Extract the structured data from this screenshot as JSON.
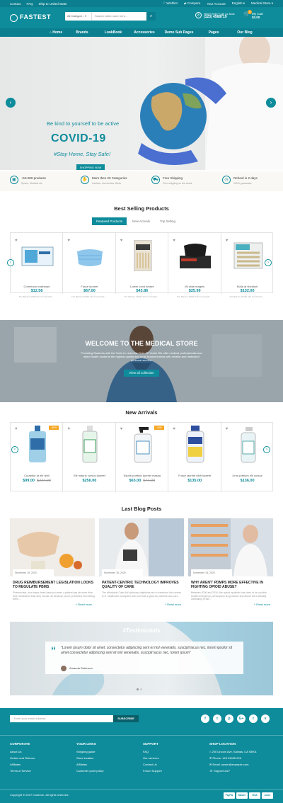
{
  "topbar": {
    "left": [
      "Contact",
      "FAQ",
      "Ship to United State"
    ],
    "right": [
      "♡ Wishlist",
      "⇄ Compare",
      "Your Account",
      "English ▾",
      "Medical Store ▾"
    ]
  },
  "header": {
    "logo": "FASTEST",
    "search_category": "All Categori... ▾",
    "search_placeholder": "Search entire store here...",
    "help_label": "Need Help? Call us Now",
    "help_phone": "(123) 4568719",
    "cart_label": "My Cart",
    "cart_total": "$0.00",
    "cart_count": "0"
  },
  "nav": [
    "Home",
    "Brands",
    "LookBook",
    "Accessories",
    "Demo Sub Pages",
    "Pages",
    "Our Blog"
  ],
  "hero": {
    "line1": "Be kind to yourself to be active",
    "line2": "COVID-19",
    "line3": "#Stay Home, Stay Safe!",
    "button": "SHOPPING NOW"
  },
  "features": [
    {
      "title": "+15.000 products",
      "sub": "Sports, Medical etc",
      "icon": "box-icon"
    },
    {
      "title": "More then 20 Categories",
      "sub": "Fashion, electronics, Book",
      "icon": "thumb-icon"
    },
    {
      "title": "Free Shipping",
      "sub": "Free shipping on the world.",
      "icon": "truck-icon"
    },
    {
      "title": "Refund in 2 days",
      "sub": "100% guarantee",
      "icon": "clock-icon"
    }
  ],
  "best_selling": {
    "title": "Best Selling Products",
    "tabs": [
      "Featured Products",
      "New Arrivals",
      "Top Selling"
    ],
    "products": [
      {
        "name": "Commodo malesuae",
        "price": "$12.56",
        "desc": "The Balnius 30290-110 Comfortabl..."
      },
      {
        "name": "Fusce laoreet",
        "price": "$67.00",
        "desc": "The Balnius 30290-110 Comfortabl..."
      },
      {
        "name": "Lorem cond amare",
        "price": "$43.86",
        "desc": "The Balnius 30290-110 Comfortabl..."
      },
      {
        "name": "Mi vitae magnis",
        "price": "$25.99",
        "desc": "The Balnius 30290-110 Comfortabl..."
      },
      {
        "name": "Nulla at tincidunt",
        "price": "$132.00",
        "desc": "The Balnius 30290-110 Comfortabl..."
      }
    ]
  },
  "banner": {
    "title": "WELCOME TO THE MEDICAL STORE",
    "desc": "Providing Students with the Tools to Learn for Over 20 Years! We offer medical professionals and allied health students the highest quality and most trusted brands with reliable and dedicated personal service.",
    "button": "View all collection"
  },
  "new_arrivals": {
    "title": "New Arrivals",
    "products": [
      {
        "name": "Curabitur at elit nibh",
        "price": "$99.00",
        "old": "$234.00",
        "sale": "-50%"
      },
      {
        "name": "Elit mauris cursus laoreet",
        "price": "$256.00",
        "old": "",
        "sale": ""
      },
      {
        "name": "Espire porttitor laoreet massa",
        "price": "$65.00",
        "old": "$77.00",
        "sale": "-15%"
      },
      {
        "name": "Fusce laoreet nibh laoreet",
        "price": "$135.00",
        "old": "",
        "sale": ""
      },
      {
        "name": "Urna pretium elit cursus",
        "price": "$136.00",
        "old": "",
        "sale": ""
      }
    ]
  },
  "blog": {
    "title": "Last Blog Posts",
    "posts": [
      {
        "date": "November 15, 2020",
        "title": "DRUG REIMBURSEMENT LEGISLATION LOOKS TO REGULATE PBMS",
        "excerpt": "Pharmacists, how many times have you seen a patient pay far more than their medication than they should, all because you're prohibited from telling them...",
        "more": "+ Read more"
      },
      {
        "date": "November 15, 2020",
        "title": "PATIENT-CENTRIC TECHNOLOGY IMPROVES QUALITY OF CARE",
        "excerpt": "The affordable Care Act's primary objectives are to transform the current U.S. healthcare ecosystem into one that is good for patients who can...",
        "more": "+ Read more"
      },
      {
        "date": "November 15, 2020",
        "title": "WHY AREN'T PDMPS MORE EFFECTIVE IN FIGHTING OPIOID ABUSE?",
        "excerpt": "Between 2000 and 2016, the opioid epidemic has risen to be a public health emergency, prescription drug misuse and abuse were steadily increasing in the...",
        "more": "+ Read more"
      }
    ]
  },
  "testimonials": {
    "title": "#Testimonials",
    "quote": "\"Lorem ipsum dolor sit amet, consectetur adipiscing sent et nisl venenatis, suscipit lacus nec, lorem ipsolor sit amet consectetur adipiscing sent et nisl venenatis, suscipit lacus nec, lorem ipsum\"",
    "author": "Amanda Robinson"
  },
  "footer": {
    "newsletter_placeholder": "Enter your email address",
    "subscribe": "SUBSCRIBE",
    "social": [
      "f",
      "t",
      "p",
      "G+",
      "t",
      "v"
    ],
    "cols": [
      {
        "title": "CORPORATE",
        "links": [
          "About Us",
          "Orders and Returns",
          "Affiliates",
          "Terms of Service"
        ]
      },
      {
        "title": "YOUR LINKS",
        "links": [
          "Shipping guide",
          "Store location",
          "Affiliates",
          "Customer point policy"
        ]
      },
      {
        "title": "SUPPORT",
        "links": [
          "FAQ",
          "Our services",
          "Contact Us",
          "Forum Support"
        ]
      },
      {
        "title": "SHOP LOCATION",
        "links": [
          "⌂ 200 Lincoln Ave, Salinas, CA 93901",
          "✆ Phone: 123 33425 225",
          "✉ Email: owner@example.com",
          "☏ Support 24/7"
        ]
      }
    ],
    "copyright": "Copyright © 2017 Codezon. All rights reserved.",
    "payments": [
      "PayPal",
      "Master",
      "VISA",
      "Amex"
    ]
  }
}
